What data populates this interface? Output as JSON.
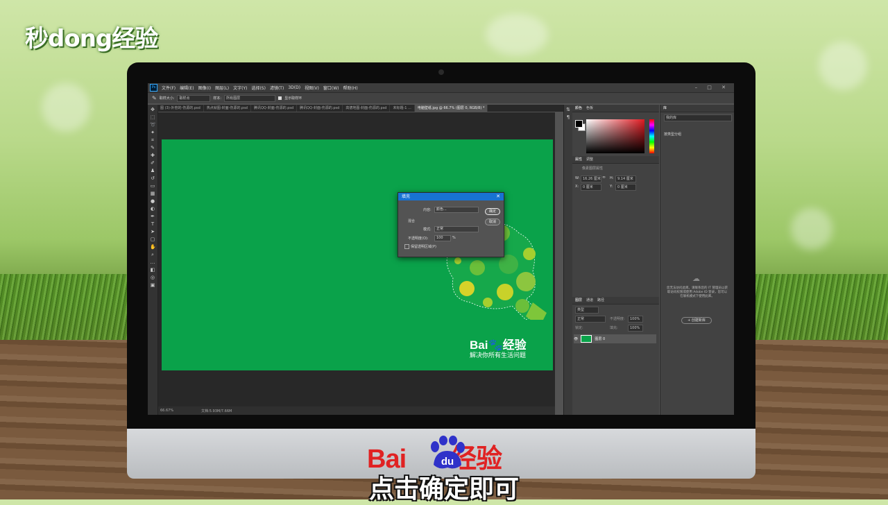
{
  "watermark": "秒dong经验",
  "ps": {
    "menu": [
      "文件(F)",
      "编辑(E)",
      "图像(I)",
      "图层(L)",
      "文字(Y)",
      "选择(S)",
      "滤镜(T)",
      "3D(D)",
      "视图(V)",
      "窗口(W)",
      "帮助(H)"
    ],
    "window_controls": "– □ ✕",
    "options": {
      "sample_size_label": "取样大小:",
      "sample_size": "取样点",
      "sample_label": "样本:",
      "sample": "所有图层",
      "show_ring": "显示取样环"
    },
    "tabs": [
      "图 (3)-外管的-伤源的.psd",
      "热点就图-封面-伤源的.psd",
      "腾讯QQ-封面-伤源的.psd",
      "腾讯QQ-封面-伤源的.psd",
      "高德地图-封面-伤源的.psd",
      "未标题-1 ...",
      "电脑壁纸.jpg @ 66.7% (图层 0, RGB/8) *"
    ],
    "status": {
      "zoom": "66.67%",
      "doc": "文档:5.93M/7.66M"
    },
    "document": {
      "logo": "Bai🐾经验",
      "slogan": "解决你所有生活问题"
    },
    "dialog": {
      "title": "填充",
      "close": "✕",
      "content_label": "内容:",
      "content_value": "颜色...",
      "blend_section": "混合",
      "mode_label": "模式:",
      "mode_value": "正常",
      "opacity_label": "不透明度(O):",
      "opacity_value": "100",
      "opacity_unit": "%",
      "preserve": "保留透明区域(P)",
      "ok": "确定",
      "cancel": "取消"
    },
    "panels": {
      "color_tabs": [
        "颜色",
        "色板"
      ],
      "props_tabs": [
        "属性",
        "调整"
      ],
      "props_title": "像素图层属性",
      "w_label": "W:",
      "w_value": "16.26 厘米",
      "h_label": "H:",
      "h_value": "9.14 厘米",
      "x_label": "X:",
      "x_value": "0 厘米",
      "y_label": "Y:",
      "y_value": "0 厘米",
      "layers_tabs": [
        "图层",
        "通道",
        "路径"
      ],
      "layer_kind": "类型",
      "blend_mode": "正常",
      "opacity_label": "不透明度:",
      "opacity": "100%",
      "lock_label": "锁定:",
      "fill_label": "填充:",
      "fill": "100%",
      "layer_name": "图层 0",
      "library_tab": "库",
      "library_select": "我的库",
      "library_view": "按类型分组",
      "library_msg": "您无法访问此库。请联系您的 IT 管理员以获取访问权限或使用 Adobe ID 登录，您可以在联机模式下使用此库。",
      "library_btn": "+ 创建新库"
    }
  },
  "chin_logo": "Bai",
  "chin_logo_tail": "经验",
  "paw_text": "du",
  "caption": "点击确定即可"
}
